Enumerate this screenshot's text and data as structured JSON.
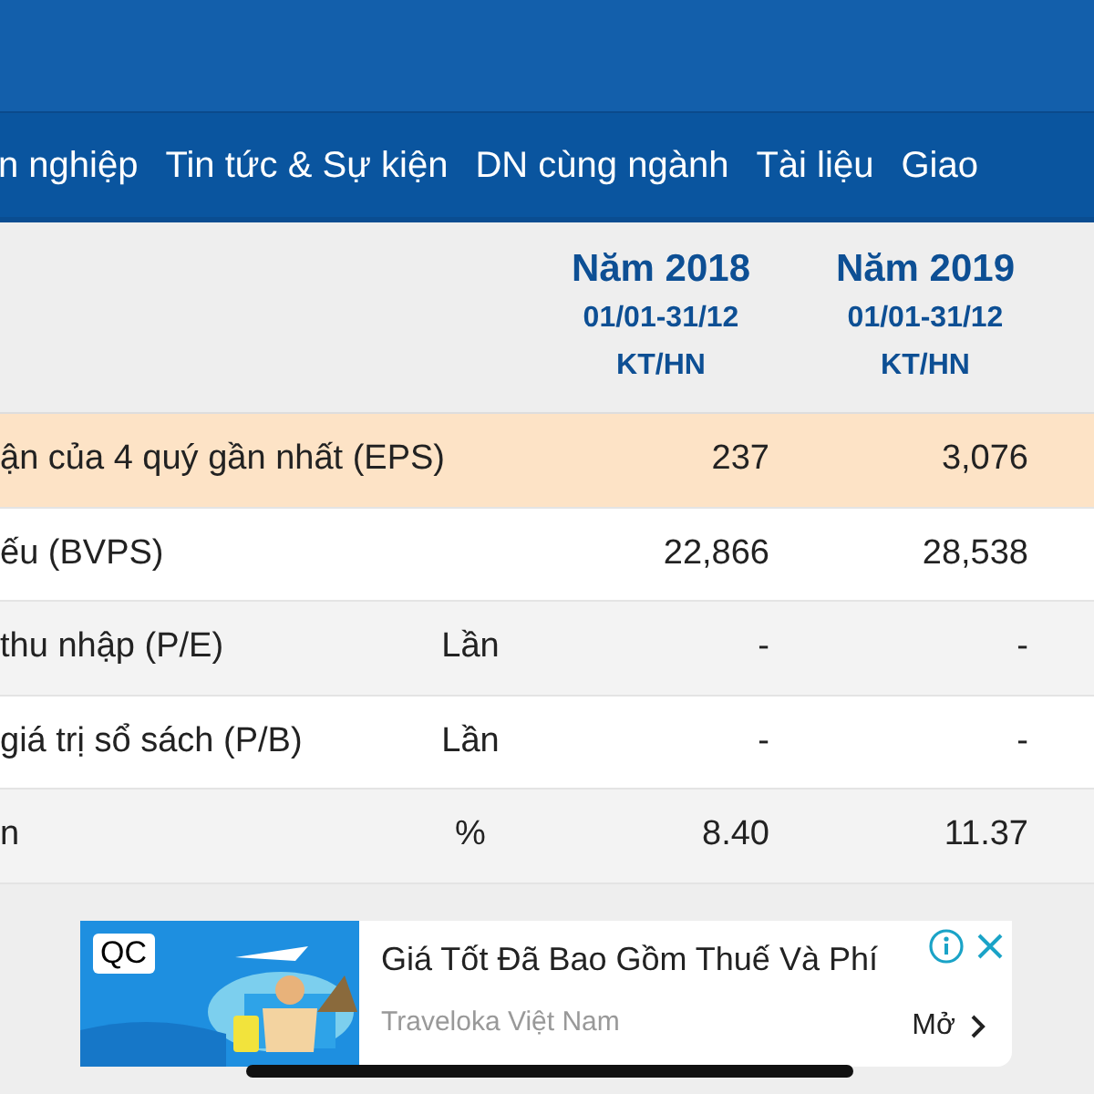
{
  "nav": {
    "items": [
      {
        "label": "n nghiệp"
      },
      {
        "label": "Tin tức & Sự kiện"
      },
      {
        "label": "DN cùng ngành"
      },
      {
        "label": "Tài liệu"
      },
      {
        "label": "Giao"
      }
    ]
  },
  "table": {
    "columns": [
      {
        "year": "Năm 2018",
        "period": "01/01-31/12",
        "type": "KT/HN"
      },
      {
        "year": "Năm 2019",
        "period": "01/01-31/12",
        "type": "KT/HN"
      }
    ],
    "rows": [
      {
        "label": "ận của 4 quý gần nhất (EPS)",
        "unit": "",
        "values": [
          "237",
          "3,076"
        ],
        "highlighted": true
      },
      {
        "label": "ếu (BVPS)",
        "unit": "",
        "values": [
          "22,866",
          "28,538"
        ],
        "highlighted": false
      },
      {
        "label": "thu nhập (P/E)",
        "unit": "Lần",
        "values": [
          "-",
          "-"
        ],
        "highlighted": false
      },
      {
        "label": "giá trị sổ sách (P/B)",
        "unit": "Lần",
        "values": [
          "-",
          "-"
        ],
        "highlighted": false
      },
      {
        "label": "n",
        "unit": "%",
        "values": [
          "8.40",
          "11.37"
        ],
        "highlighted": false
      }
    ]
  },
  "ad": {
    "badge": "QC",
    "title": "Giá Tốt Đã Bao Gồm Thuế Và Phí",
    "subtitle": "Traveloka Việt Nam",
    "action": "Mở"
  }
}
